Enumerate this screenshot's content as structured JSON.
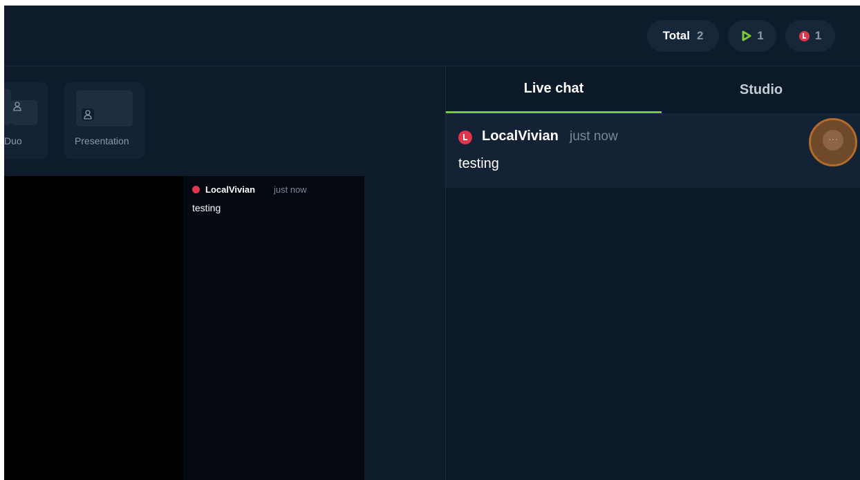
{
  "header": {
    "total_label": "Total",
    "total_count": "2",
    "youtube_count": "1",
    "restream_count": "1"
  },
  "layouts": [
    {
      "label": "Duo"
    },
    {
      "label": "Presentation"
    }
  ],
  "preview_chat": {
    "username": "LocalVivian",
    "time": "just now",
    "message": "testing"
  },
  "chat_panel": {
    "tabs": [
      {
        "label": "Live chat"
      },
      {
        "label": "Studio"
      }
    ],
    "messages": [
      {
        "username": "LocalVivian",
        "time": "just now",
        "text": "testing"
      }
    ],
    "more_button": "···"
  },
  "colors": {
    "accent_green": "#79c93a",
    "alert_red": "#e0354b",
    "highlight_orange": "#b46a28"
  }
}
